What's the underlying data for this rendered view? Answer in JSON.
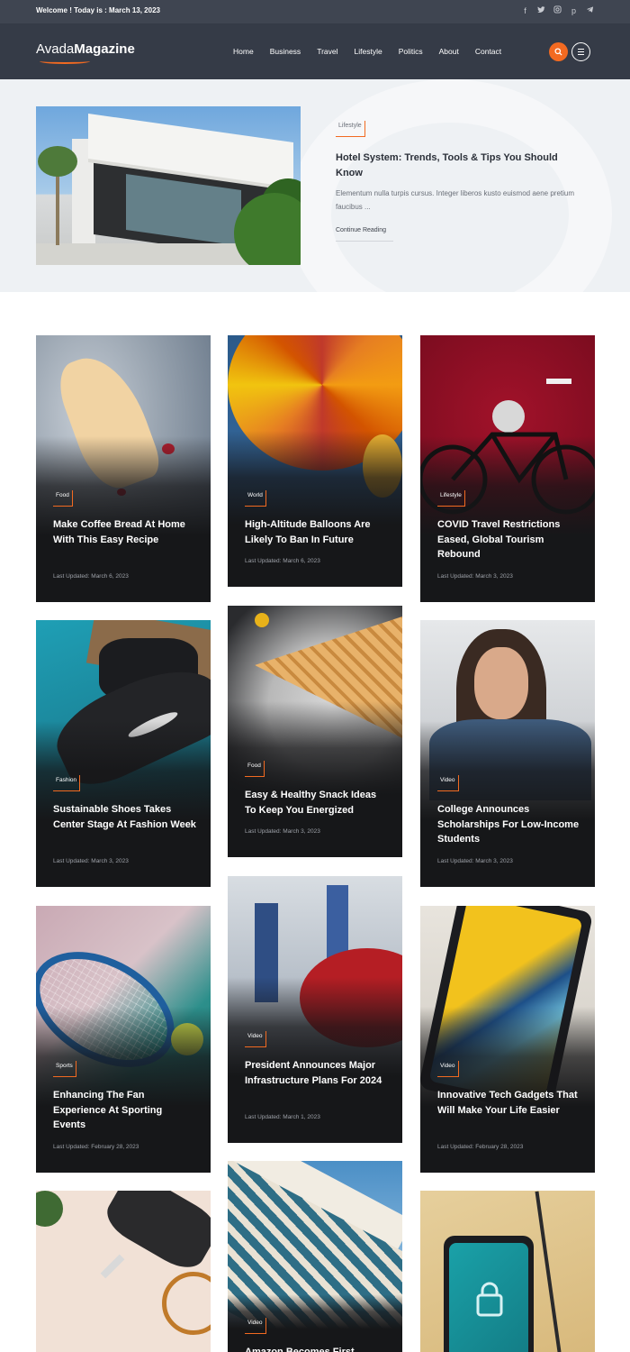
{
  "topbar": {
    "welcome": "Welcome ! Today is : March 13, 2023",
    "socials": [
      "facebook-icon",
      "twitter-icon",
      "instagram-icon",
      "pinterest-icon",
      "telegram-icon"
    ]
  },
  "nav": {
    "logo_light": "Avada",
    "logo_bold": "Magazine",
    "menu": [
      "Home",
      "Business",
      "Travel",
      "Lifestyle",
      "Politics",
      "About",
      "Contact"
    ]
  },
  "colors": {
    "accent": "#f26a21",
    "nav_bg": "#353b47",
    "topbar_bg": "#3f4551",
    "hero_bg": "#eef1f4",
    "card_bg": "#161719"
  },
  "hero": {
    "category": "Lifestyle",
    "title": "Hotel System: Trends, Tools & Tips You Should Know",
    "excerpt": "Elementum nulla turpis cursus. Integer liberos kusto euismod aene pretium faucibus ...",
    "read_more": "Continue Reading"
  },
  "cards": [
    {
      "category": "Food",
      "title": "Make Coffee Bread At Home With This Easy Recipe",
      "date": "Last Updated: March 6, 2023"
    },
    {
      "category": "World",
      "title": "High-Altitude Balloons Are Likely To Ban In Future",
      "date": "Last Updated: March 6, 2023"
    },
    {
      "category": "Lifestyle",
      "title": "COVID Travel Restrictions Eased, Global Tourism Rebound",
      "date": "Last Updated: March 3, 2023"
    },
    {
      "category": "Fashion",
      "title": "Sustainable Shoes Takes Center Stage At Fashion Week",
      "date": "Last Updated: March 3, 2023"
    },
    {
      "category": "Food",
      "title": "Easy & Healthy Snack Ideas To Keep You Energized",
      "date": "Last Updated: March 3, 2023"
    },
    {
      "category": "Video",
      "title": "College Announces Scholarships For Low-Income Students",
      "date": "Last Updated: March 3, 2023"
    },
    {
      "category": "Sports",
      "title": "Enhancing The Fan Experience At Sporting Events",
      "date": "Last Updated: February 28, 2023"
    },
    {
      "category": "Video",
      "title": "President Announces Major Infrastructure Plans For 2024",
      "date": "Last Updated: March 1, 2023"
    },
    {
      "category": "Video",
      "title": "Innovative Tech Gadgets That Will Make Your Life Easier",
      "date": "Last Updated: February 28, 2023"
    },
    {
      "category": "Video",
      "title": "Amazon Becomes First"
    }
  ]
}
